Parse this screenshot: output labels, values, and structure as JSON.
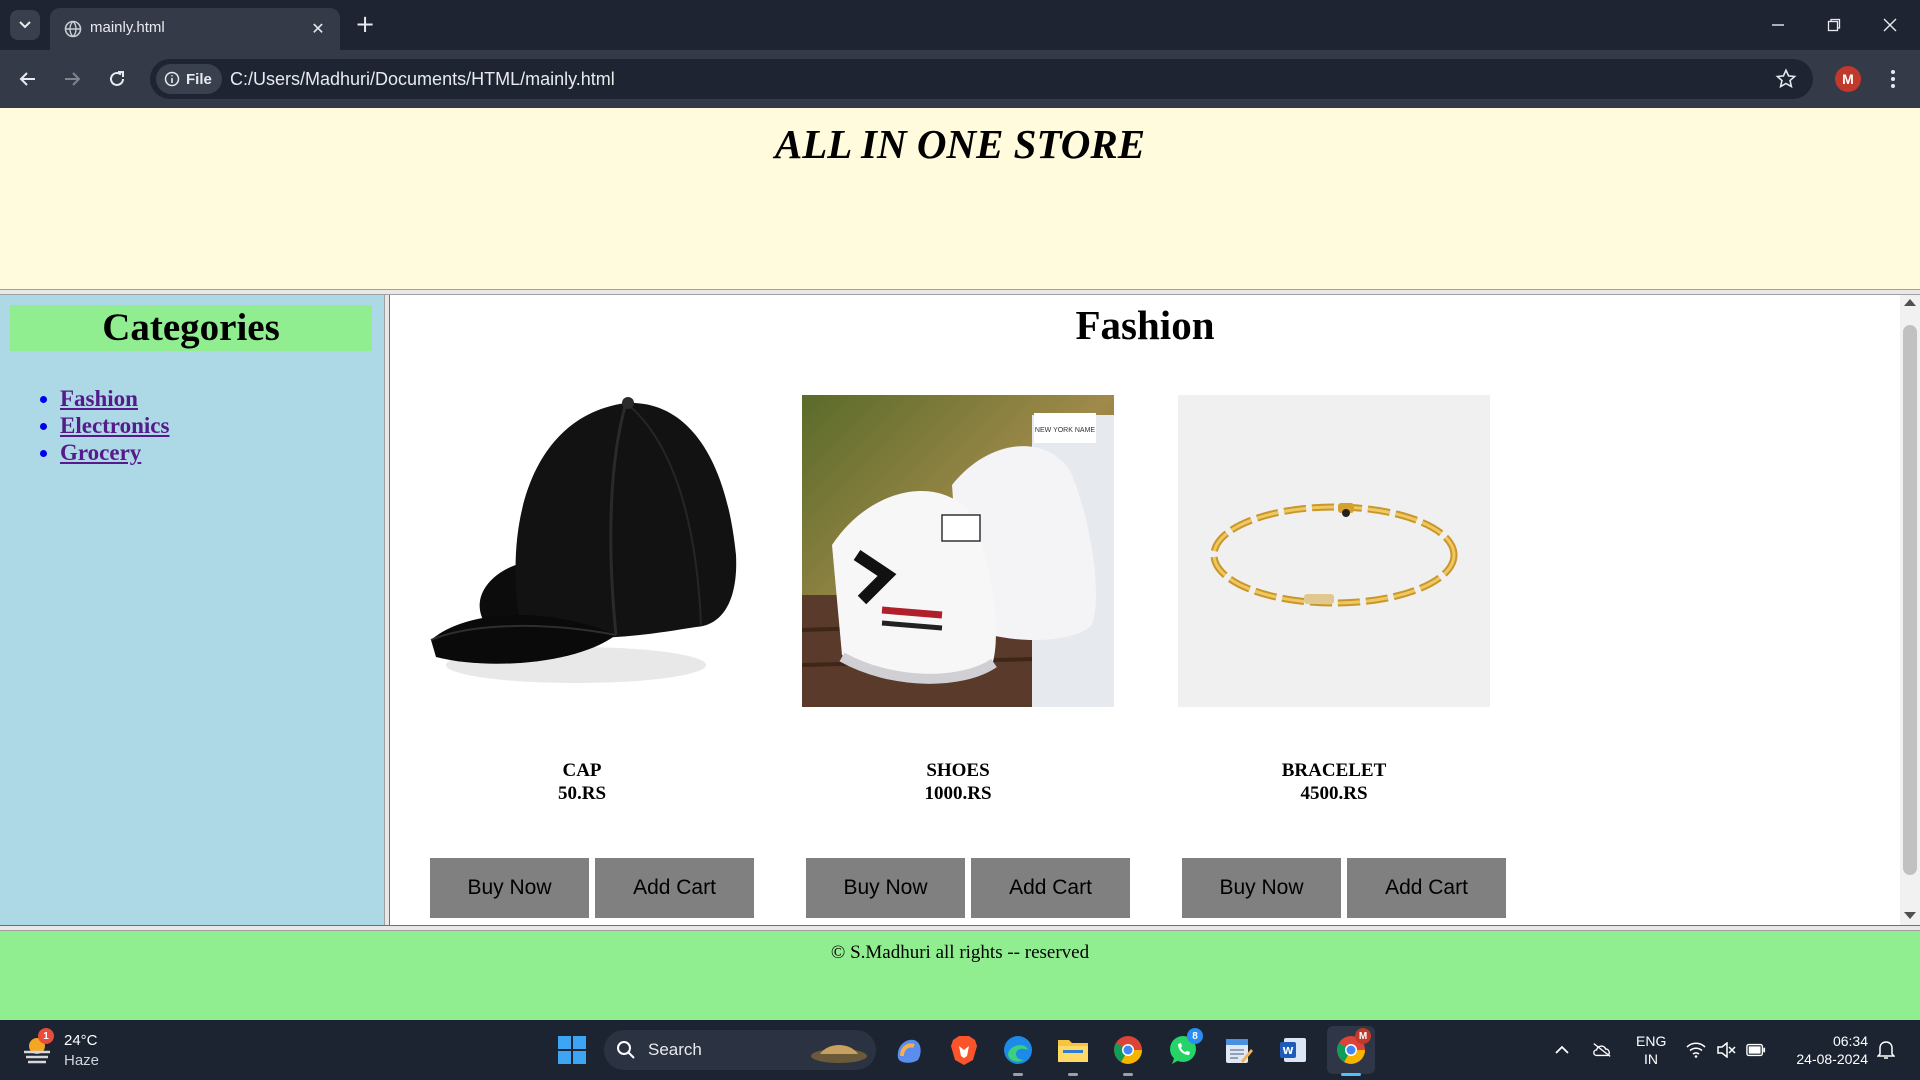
{
  "browser": {
    "tab_title": "mainly.html",
    "new_tab_symbol": "+",
    "close_symbol": "✕",
    "file_chip_label": "File",
    "url": "C:/Users/Madhuri/Documents/HTML/mainly.html",
    "profile_initial": "M"
  },
  "page": {
    "store_title": "ALL IN ONE STORE",
    "sidebar": {
      "heading": "Categories",
      "items": [
        "Fashion",
        "Electronics",
        "Grocery"
      ]
    },
    "content": {
      "section_title": "Fashion",
      "products": [
        {
          "name": "CAP",
          "price": "50.RS",
          "buy_label": "Buy Now",
          "cart_label": "Add Cart"
        },
        {
          "name": "SHOES",
          "price": "1000.RS",
          "buy_label": "Buy Now",
          "cart_label": "Add Cart"
        },
        {
          "name": "BRACELET",
          "price": "4500.RS",
          "buy_label": "Buy Now",
          "cart_label": "Add Cart"
        }
      ],
      "shoe_tag": "NEW YORK NAME"
    },
    "footer_text": "© S.Madhuri all rights -- reserved",
    "colors": {
      "header_bg": "#fffbdc",
      "sidebar_bg": "#add8e6",
      "category_heading_bg": "#90ee90",
      "footer_bg": "#90ee90",
      "button_bg": "#808080"
    }
  },
  "taskbar": {
    "weather_badge": "1",
    "temperature": "24°C",
    "condition": "Haze",
    "search_label": "Search",
    "whatsapp_badge": "8",
    "chrome_badge": "M",
    "lang_line1": "ENG",
    "lang_line2": "IN",
    "time": "06:34",
    "date": "24-08-2024"
  }
}
